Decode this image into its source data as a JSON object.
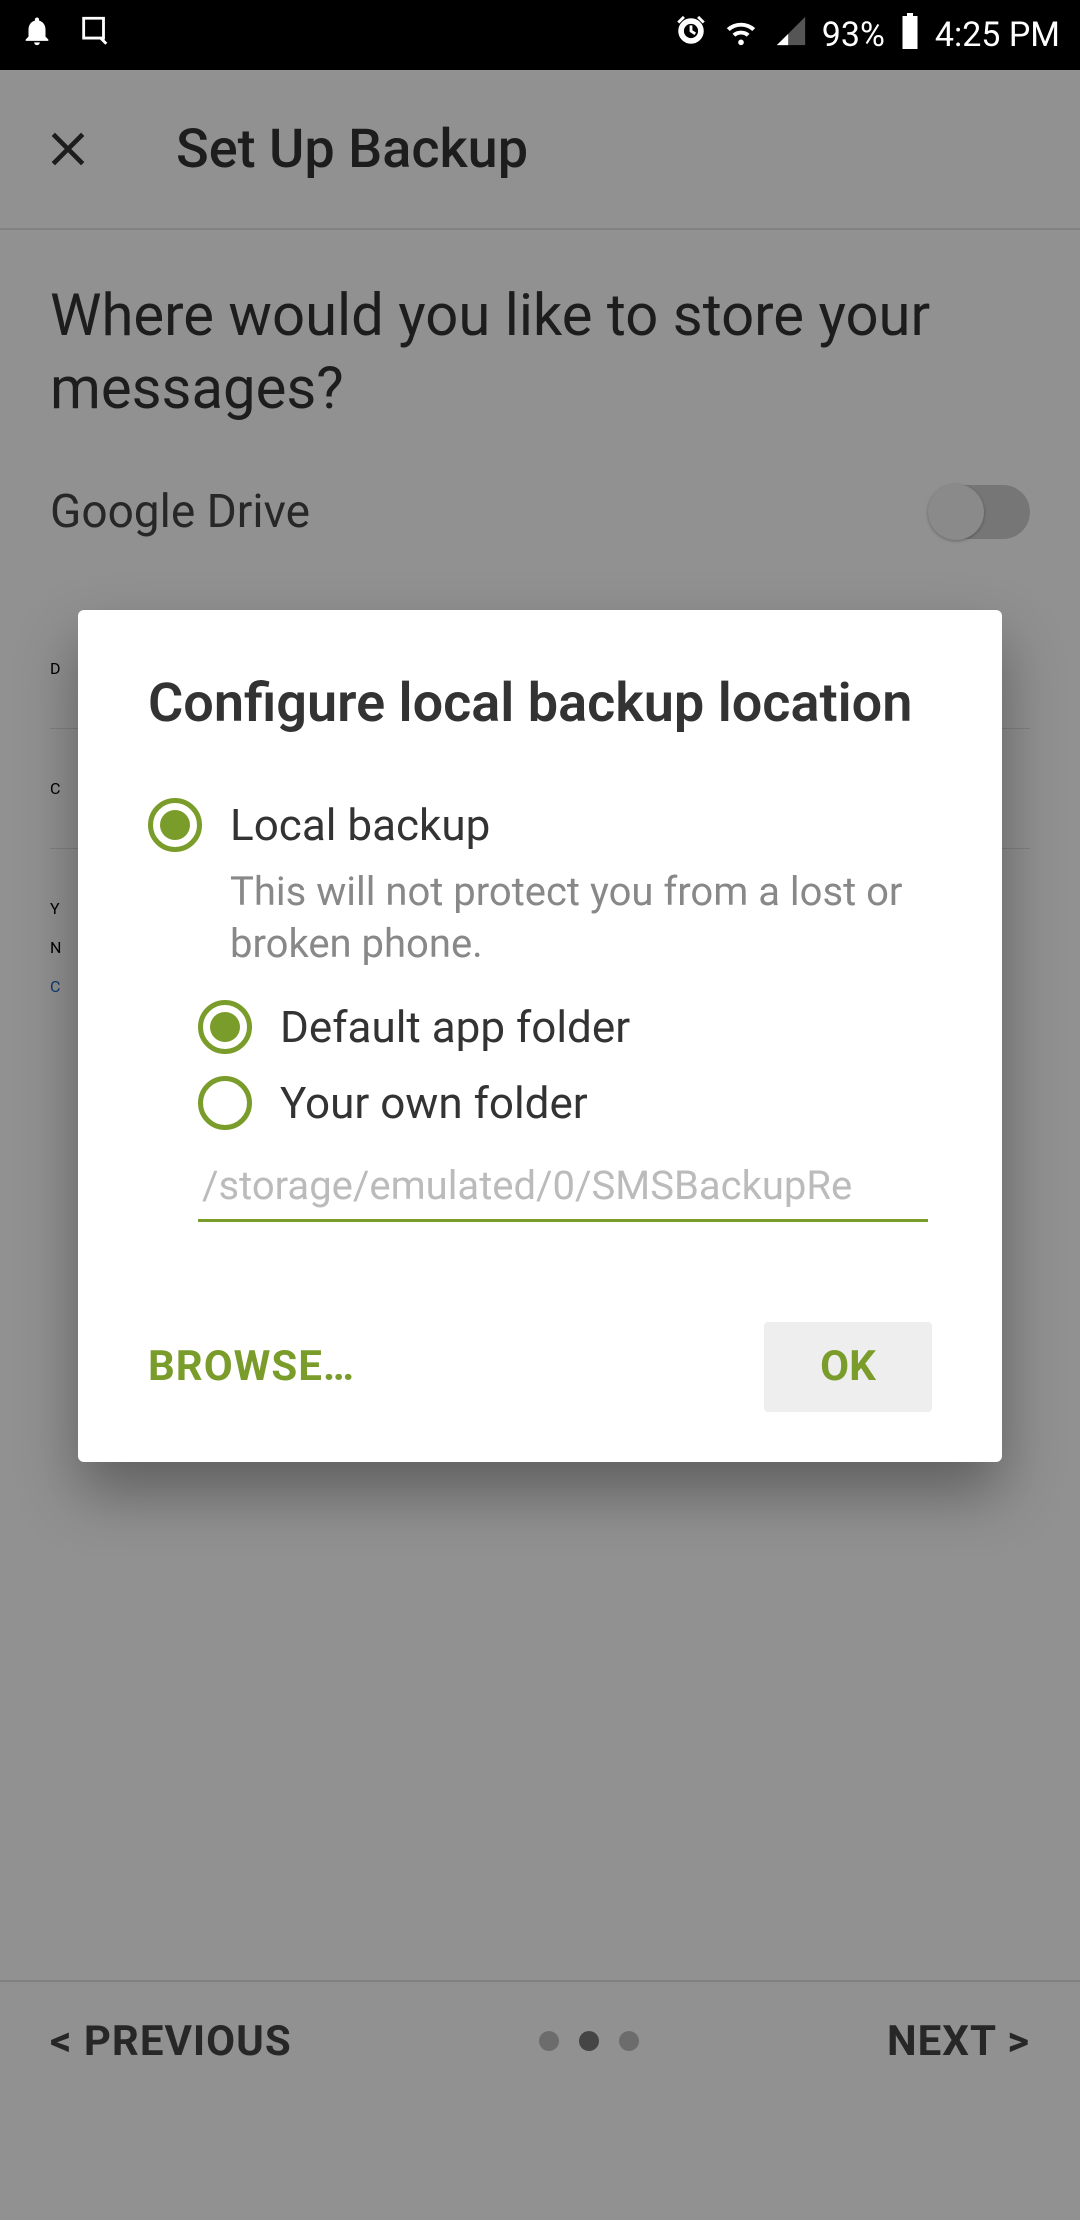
{
  "status": {
    "battery_pct": "93%",
    "time": "4:25 PM"
  },
  "appbar": {
    "title": "Set Up Backup"
  },
  "page": {
    "question": "Where would you like to store your messages?",
    "google_drive_label": "Google Drive",
    "row_d": "D",
    "row_c": "C",
    "row_y": "Y",
    "row_n": "N",
    "row_cc": "C"
  },
  "dialog": {
    "title": "Configure local backup location",
    "local_backup": "Local backup",
    "local_backup_sub": "This will not protect you from a lost or broken phone.",
    "default_folder": "Default app folder",
    "own_folder": "Your own folder",
    "path_value": "/storage/emulated/0/SMSBackupRe",
    "browse": "BROWSE…",
    "ok": "OK"
  },
  "nav": {
    "prev": "<  PREVIOUS",
    "next": "NEXT  >"
  },
  "colors": {
    "accent": "#7a9c2a"
  }
}
